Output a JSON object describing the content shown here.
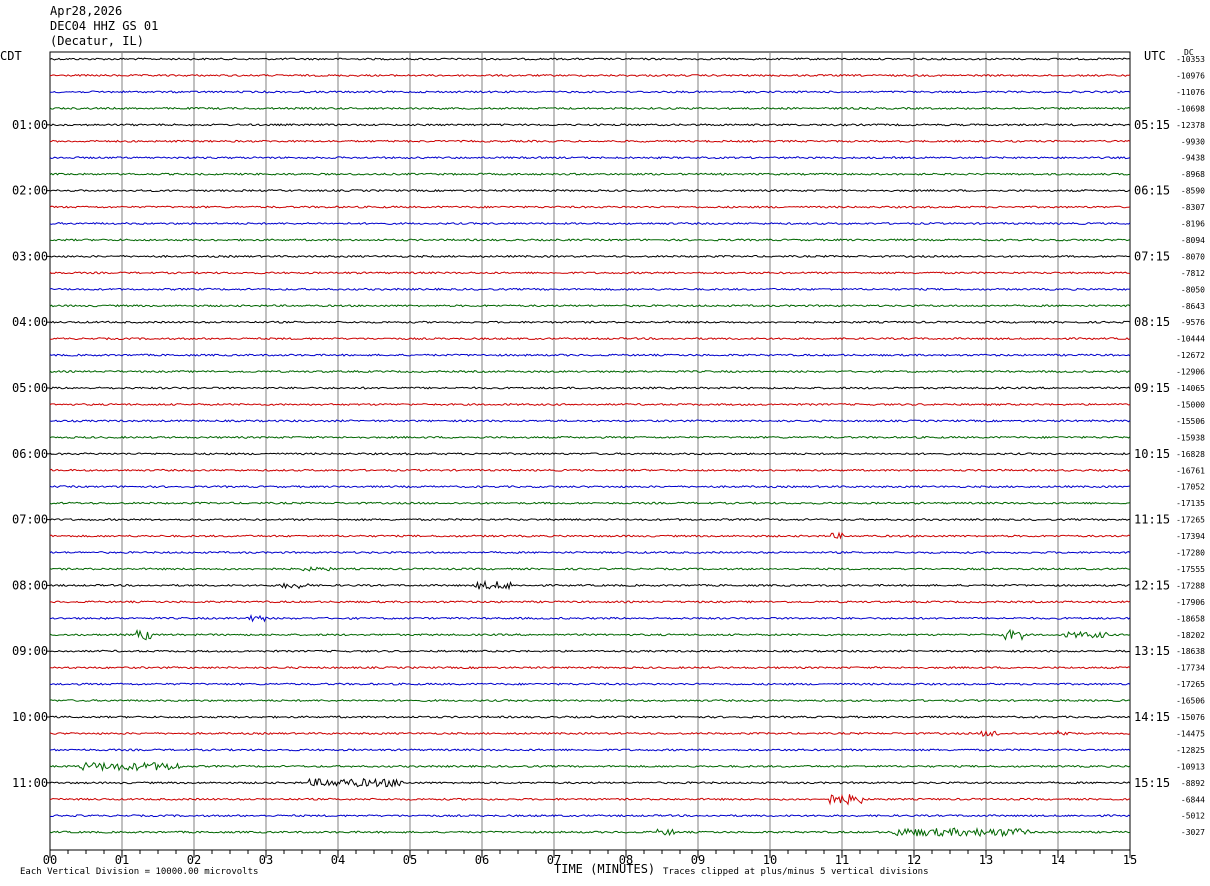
{
  "header": {
    "date": "Apr28,2026",
    "station": "DEC04 HHZ GS 01",
    "location": "(Decatur, IL)"
  },
  "left_tz": "CDT",
  "right_tz": "UTC",
  "dc_label": "DC",
  "footer": {
    "scale": "Each Vertical Division = 10000.00 microvolts",
    "clip": "Traces clipped at plus/minus 5 vertical divisions"
  },
  "colors": {
    "trace": [
      "#000000",
      "#cc0000",
      "#0000cc",
      "#006600"
    ],
    "grid": "#808080"
  },
  "chart_data": {
    "type": "line",
    "xlabel": "TIME (MINUTES)",
    "xlim": [
      0,
      15
    ],
    "x_ticks": [
      "00",
      "01",
      "02",
      "03",
      "04",
      "05",
      "06",
      "07",
      "08",
      "09",
      "10",
      "11",
      "12",
      "13",
      "14",
      "15"
    ],
    "left_hour_labels": [
      "01:00",
      "02:00",
      "03:00",
      "04:00",
      "05:00",
      "06:00",
      "07:00",
      "08:00",
      "09:00",
      "10:00",
      "11:00"
    ],
    "right_hour_labels": [
      "05:15",
      "06:15",
      "07:15",
      "08:15",
      "09:15",
      "10:15",
      "11:15",
      "12:15",
      "13:15",
      "14:15",
      "15:15"
    ],
    "dc_offsets": [
      "-10353",
      "-10976",
      "-11076",
      "-10698",
      "-12378",
      "-9930",
      "-9438",
      "-8968",
      "-8590",
      "-8307",
      "-8196",
      "-8094",
      "-8070",
      "-7812",
      "-8050",
      "-8643",
      "-9576",
      "-10444",
      "-12672",
      "-12906",
      "-14065",
      "-15000",
      "-15506",
      "-15938",
      "-16828",
      "-16761",
      "-17052",
      "-17135",
      "-17265",
      "-17394",
      "-17280",
      "-17555",
      "-17288",
      "-17906",
      "-18658",
      "-18202",
      "-18638",
      "-17734",
      "-17265",
      "-16506",
      "-15076",
      "-14475",
      "-12825",
      "-10913",
      "-8892",
      "-6844",
      "-5012",
      "-3027"
    ],
    "traces": 48,
    "events": [
      {
        "trace": 29,
        "start_min": 10.8,
        "end_min": 11.0,
        "amp": 3
      },
      {
        "trace": 31,
        "start_min": 3.5,
        "end_min": 3.9,
        "amp": 2
      },
      {
        "trace": 32,
        "start_min": 3.2,
        "end_min": 3.6,
        "amp": 3
      },
      {
        "trace": 32,
        "start_min": 5.9,
        "end_min": 6.4,
        "amp": 4
      },
      {
        "trace": 34,
        "start_min": 2.7,
        "end_min": 3.0,
        "amp": 3
      },
      {
        "trace": 35,
        "start_min": 1.2,
        "end_min": 1.4,
        "amp": 5
      },
      {
        "trace": 35,
        "start_min": 13.2,
        "end_min": 13.5,
        "amp": 5
      },
      {
        "trace": 35,
        "start_min": 14.1,
        "end_min": 14.7,
        "amp": 3
      },
      {
        "trace": 41,
        "start_min": 12.9,
        "end_min": 13.2,
        "amp": 3
      },
      {
        "trace": 41,
        "start_min": 14.0,
        "end_min": 14.2,
        "amp": 3
      },
      {
        "trace": 43,
        "start_min": 0.4,
        "end_min": 1.8,
        "amp": 4
      },
      {
        "trace": 44,
        "start_min": 3.6,
        "end_min": 4.9,
        "amp": 4
      },
      {
        "trace": 45,
        "start_min": 10.8,
        "end_min": 11.3,
        "amp": 5
      },
      {
        "trace": 47,
        "start_min": 8.4,
        "end_min": 8.7,
        "amp": 3
      },
      {
        "trace": 47,
        "start_min": 11.7,
        "end_min": 13.6,
        "amp": 4
      }
    ]
  }
}
